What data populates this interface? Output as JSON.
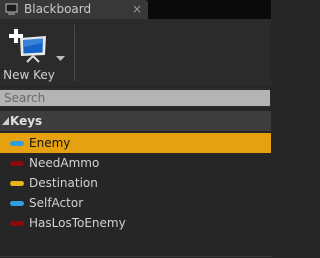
{
  "tab": {
    "title": "Blackboard",
    "close_glyph": "×",
    "icon": "blackboard-tab-icon"
  },
  "toolbar": {
    "new_key_label": "New Key",
    "new_key_icon": "new-key-monitor-plus-icon",
    "dropdown_icon": "chevron-down-icon"
  },
  "search": {
    "placeholder": "Search",
    "value": ""
  },
  "category": {
    "label": "Keys",
    "expanded": true,
    "icon": "collapse-triangle-icon"
  },
  "keys": [
    {
      "label": "Enemy",
      "type_color": "#2f9fe0",
      "selected": true
    },
    {
      "label": "NeedAmmo",
      "type_color": "#8a0b0b",
      "selected": false
    },
    {
      "label": "Destination",
      "type_color": "#e6b31a",
      "selected": false
    },
    {
      "label": "SelfActor",
      "type_color": "#2f9fe0",
      "selected": false
    },
    {
      "label": "HasLosToEnemy",
      "type_color": "#8a0b0b",
      "selected": false
    }
  ],
  "colors": {
    "selection": "#e5a10f",
    "panel_background": "#262626",
    "object_key": "#2f9fe0",
    "bool_key": "#8a0b0b",
    "vector_key": "#e6b31a"
  }
}
